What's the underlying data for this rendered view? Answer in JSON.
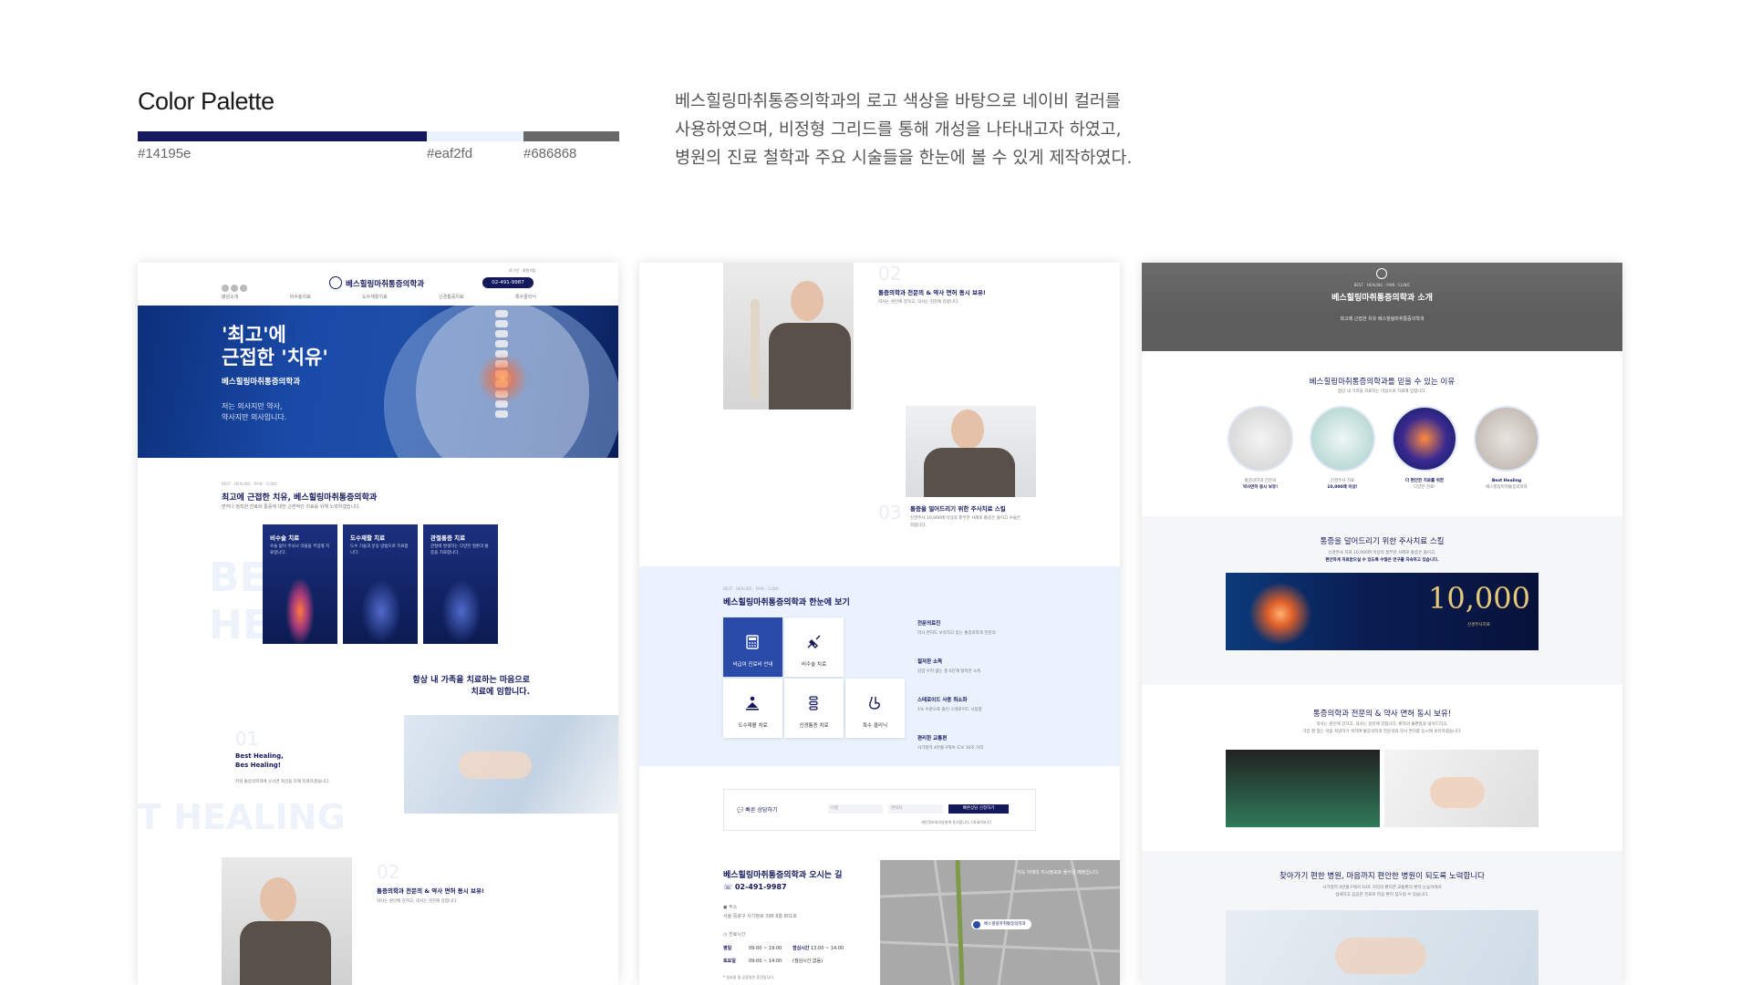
{
  "header": {
    "title": "Color Palette",
    "description_lines": [
      "베스힐링마취통증의학과의 로고 색상을 바탕으로 네이비 컬러를",
      "사용하였으며, 비정형 그리드를 통해 개성을 나타내고자 하였고,",
      "병원의 진료 철학과 주요 시술들을 한눈에 볼 수 있게 제작하였다."
    ]
  },
  "palette": [
    {
      "hex": "#14195e"
    },
    {
      "hex": "#eaf2fd"
    },
    {
      "hex": "#686868"
    }
  ],
  "card1": {
    "logo_name": "베스힐링마취통증의학과",
    "phone": "02-491-9987",
    "nav": [
      "병원소개",
      "비수술치료",
      "도수재활치료",
      "신경통증치료",
      "특수클리닉"
    ],
    "hero_line1": "'최고'에",
    "hero_line2": "근접한 '치유'",
    "hero_sub": "베스힐링마취통증의학과",
    "hero_quote1": "저는 의사지만 약사,",
    "hero_quote2": "약사지만 의사입니다.",
    "section_eyebrow": "BEST · HEALING · PAIN · CLINIC",
    "section_title": "최고에 근접한 치유, 베스힐링마취통증의학과",
    "section_desc": "면허나 정직한 진료와 통증에 대한 근본적인 치료를 위해 노력하겠습니다.",
    "cards": [
      {
        "title": "비수술 치료",
        "desc": "수술 없이 주사나 약물을 주입해 치료합니다."
      },
      {
        "title": "도수재활 치료",
        "desc": "도수 기술과 운동 방법으로 치료합니다."
      },
      {
        "title": "관절통증 치료",
        "desc": "관절에 발생하는 다양한 질환과 통증을 치료합니다."
      }
    ],
    "bg_text_1": "BEST",
    "bg_text_2": "HEALING",
    "care_title1": "항상 내 가족을 치료하는 마음으로",
    "care_title2": "치료에 임합니다.",
    "num_01": "01",
    "best_title1": "Best Healing,",
    "best_title2": "Bes Healing!",
    "best_desc": "저희 통증의학과에 오시면 최선을 다해 진료하겠습니다.",
    "bg_text_3": "T HEALING",
    "num_02": "02",
    "doctor_title": "통증의학과 전문의 & 약사 면허 동시 보유!",
    "doctor_desc": "약사는 원인에 강하고, 의사는 검진에 강합니다."
  },
  "card2": {
    "num_02": "02",
    "doctor_title": "통증의학과 전문의 & 약사 면허 동시 보유!",
    "doctor_desc": "약사는 원인에 강하고, 의사는 검진에 강합니다.",
    "num_03": "03",
    "inject_title": "통증을 덜어드리기 위한 주사치료 스킬",
    "inject_desc": "신경주사 10,000례 이상의 풍부한 사례로 통증은 줄이고 수술은 피합니다.",
    "glance_eyebrow": "BEST · HEALING · PAIN · CLINIC",
    "glance_title": "베스힐링마취통증의학과 한눈에 보기",
    "tiles": [
      "비급여 진료비 안내",
      "비수술 치료",
      "도수재활 치료",
      "신경통증 치료",
      "특수 클리닉"
    ],
    "features": [
      {
        "title": "전문의료진",
        "desc": "약사 면허도 보유하고 있는 통증의학과 전문의"
      },
      {
        "title": "철저한 소독",
        "desc": "감염 우려 없는 총 6단계 철저한 소독"
      },
      {
        "title": "스테로이드 사용 최소화",
        "desc": "1% 수준으로 줄인 스테로이드 사용량"
      },
      {
        "title": "편리한 교통편",
        "desc": "사가정역 4번출구에서 도보 10초 거리"
      }
    ],
    "consult_label": "빠른 상담하기",
    "consult_btn": "빠른상담 신청하기",
    "consult_name_ph": "이름",
    "consult_phone_ph": "연락처",
    "consult_agree": "개인정보처리방침에 동의합니다. [자세히보기]",
    "map_title": "베스힐링마취통증의학과 오시는 길",
    "map_phone": "02-491-9987",
    "map_addr_label": "주소",
    "map_addr": "서울 중랑구 사가정로 398 8층 801호",
    "hours_label": "진료시간",
    "hours": [
      {
        "day": "평일",
        "time": "09:00 ~ 19:00",
        "extra_label": "점심시간",
        "extra": "13:00 ~ 14:00"
      },
      {
        "day": "토요일",
        "time": "09:00 ~ 14:00",
        "extra_label": "",
        "extra": "(점심시간 없음)"
      }
    ],
    "hours_note": "* 일요일 및 공휴일은 휴진입니다.",
    "map_notice": "지도 아래의 지시정보로 들어갈 예정입니다.",
    "map_marker": "베스힐링마취통증의학과"
  },
  "card3": {
    "eyebrow": "BEST · HEALING · PAIN · CLINIC",
    "hero_title": "베스힐링마취통증의학과 소개",
    "hero_sub": "최고에 근접한 치유 베스힐링마취통증의학과",
    "trust_title": "베스힐링마취통증의학과를 믿을 수 있는 이유",
    "trust_sub": "항상 내 가족을 치료하는 마음으로 치료에 임합니다.",
    "circles": [
      {
        "l1": "통증의학과 전문의",
        "l2": "약사면허 동시 보유!"
      },
      {
        "l1": "신경주사 치료",
        "l2": "10,000례 이상!"
      },
      {
        "l1": "더 편안한 치료를 위한",
        "l2": "다양한 진료!"
      },
      {
        "l1": "Best Healing",
        "l2": "베스힐링마취통증의학과"
      }
    ],
    "inject_title": "통증을 덜어드리기 위한 주사치료 스킬",
    "inject_desc1": "신경주사 치료 10,000여 이상의 풍부한 사례로 통증은 줄이고,",
    "inject_desc2": "편안하게 치료받으실 수 있도록 수많은 연구를 지속하고 있습니다.",
    "banner_number": "10,000",
    "banner_sub": "신경주사치료",
    "doctor_title": "통증의학과 전문의 & 약사 면허 동시 보유!",
    "doctor_desc1": "약사는 원인에 강하고, 의사는 검진에 강합니다. 환자의 불편함을 덜어드리고,",
    "doctor_desc2": "가장 잘 맞는 약을 처방하기 위하여 통증의학과 전문의와 약사 면허를 동시에 보유하였습니다.",
    "visit_title": "찾아가기 편한 병원, 마음까지 편안한 병원이 되도록 노력합니다",
    "visit_desc1": "사가정역 4번출구에서 10초 거리의 편리한 교통편의 환자 눈높이에서",
    "visit_desc2": "섬세하고 꼼꼼한 진료로 마음 편히 찾으실 수 있습니다."
  }
}
